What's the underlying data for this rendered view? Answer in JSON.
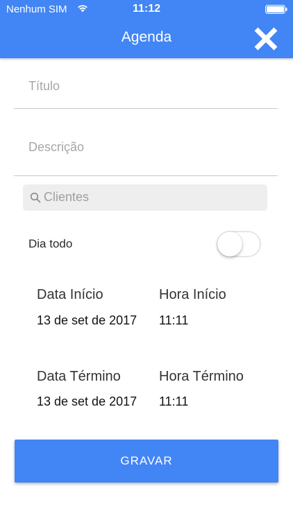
{
  "status_bar": {
    "carrier": "Nenhum SIM",
    "time": "11:12",
    "wifi_icon": "wifi-icon",
    "battery_icon": "battery-full-icon"
  },
  "header": {
    "title": "Agenda",
    "close_icon": "close-icon",
    "background_color": "#4285f4"
  },
  "form": {
    "title_field": {
      "placeholder": "Título",
      "value": ""
    },
    "description_field": {
      "placeholder": "Descrição",
      "value": ""
    },
    "client_search": {
      "placeholder": "Clientes",
      "value": "",
      "icon": "search-icon"
    },
    "all_day": {
      "label": "Dia todo",
      "enabled": false
    },
    "start": {
      "date_label": "Data Início",
      "date_value": "13 de set de 2017",
      "time_label": "Hora Início",
      "time_value": "11:11"
    },
    "end": {
      "date_label": "Data Término",
      "date_value": "13 de set de 2017",
      "time_label": "Hora Término",
      "time_value": "11:11"
    },
    "save_label": "GRAVAR"
  }
}
